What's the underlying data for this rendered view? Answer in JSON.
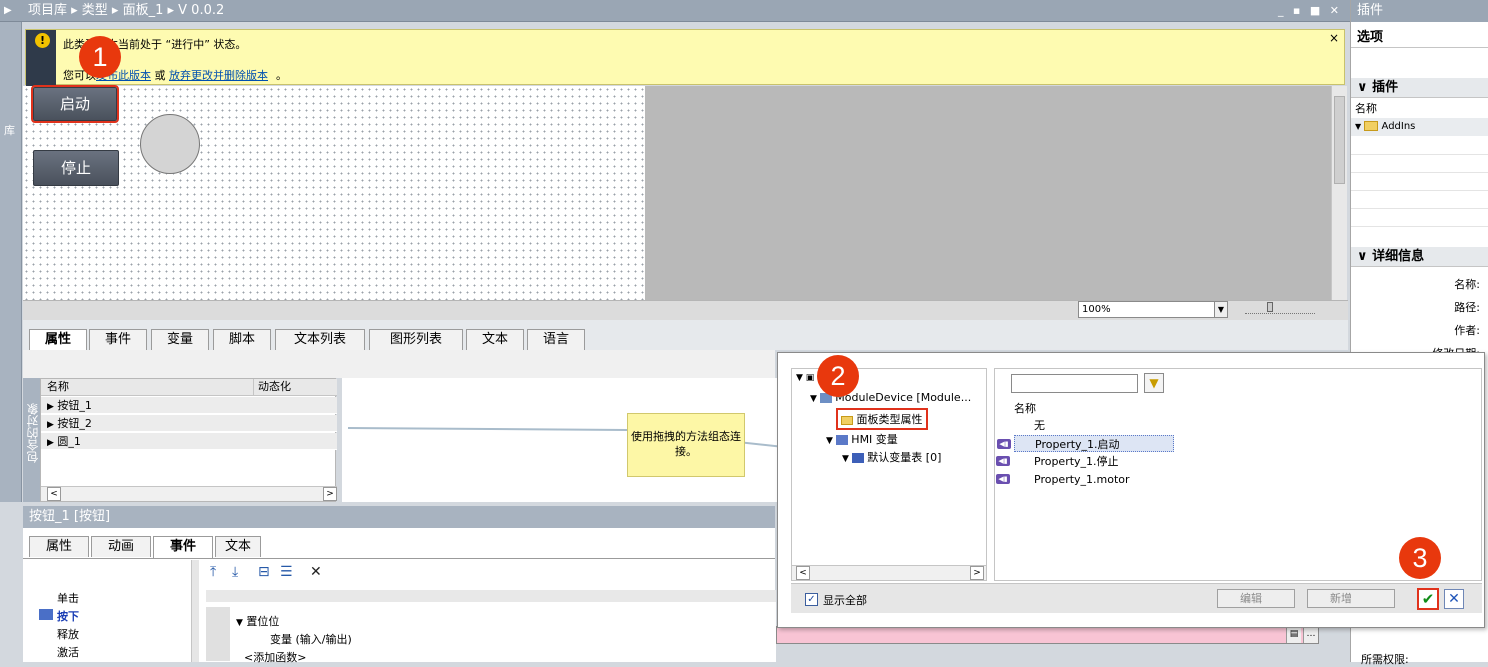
{
  "header": {
    "breadcrumb": "项目库 ▸ 类型 ▸ 面板_1 ▸ V 0.0.2",
    "window_controls": "_ ▪ ■ ✕"
  },
  "left_tab": "库",
  "notice": {
    "icon": "warning-icon",
    "line1": "此类型版本当前处于 “进行中” 状态。",
    "line2_prefix": "您可以",
    "link1": "发布此版本",
    "line2_mid": " 或 ",
    "link2": "放弃更改并删除版本",
    "line2_suffix": "。",
    "close": "×"
  },
  "canvas": {
    "btn_start": "启动",
    "btn_stop": "停止"
  },
  "zoom": {
    "value": "100%"
  },
  "tabs": [
    "属性",
    "事件",
    "变量",
    "脚本",
    "文本列表",
    "图形列表",
    "文本",
    "语言"
  ],
  "objects": {
    "side_label": "包含的对象",
    "col_name": "名称",
    "col_dyn": "动态化",
    "rows": [
      "按钮_1",
      "按钮_2",
      "圆_1"
    ]
  },
  "connection_note": "使用拖拽的方法组态连接。",
  "selection": {
    "title": "按钮_1 [按钮]",
    "tabs": [
      "属性",
      "动画",
      "事件",
      "文本"
    ]
  },
  "events": [
    "单击",
    "按下",
    "释放",
    "激活"
  ],
  "event_grid": {
    "func": "置位位",
    "param": "变量 (输入/输出)",
    "add": "<添加函数>"
  },
  "right_panel": {
    "title": "插件",
    "options": "选项",
    "plugins": "插件",
    "col_name": "名称",
    "addins": "AddIns",
    "details": "详细信息",
    "detail_labels": [
      "名称:",
      "路径:",
      "作者:",
      "修改日期:"
    ],
    "perm": "所需权限:"
  },
  "dialog": {
    "tree": [
      "ModuleDevice [Module...",
      "面板类型属性",
      "HMI 变量",
      "默认变量表 [0]"
    ],
    "col_name": "名称",
    "rows": [
      "无",
      "Property_1.启动",
      "Property_1.停止",
      "Property_1.motor"
    ],
    "show_all": "显示全部",
    "edit": "编辑",
    "new": "新增"
  },
  "badges": [
    "1",
    "2",
    "3"
  ]
}
